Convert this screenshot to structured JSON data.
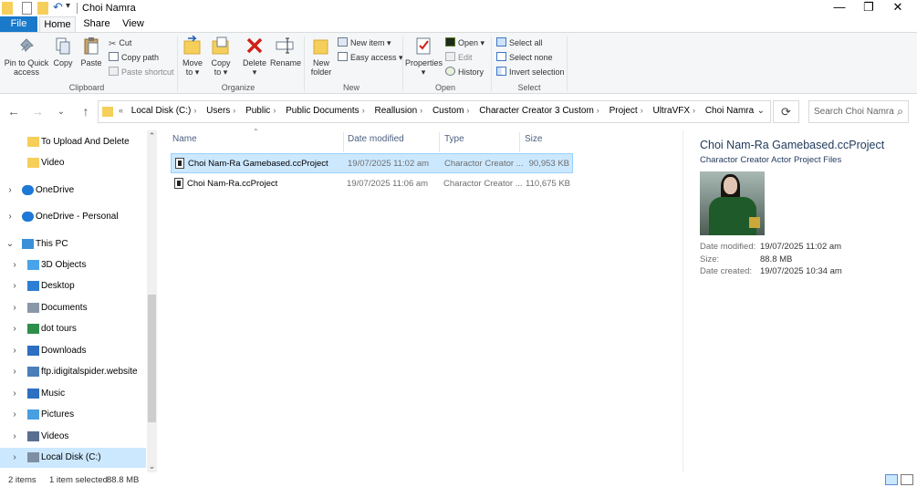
{
  "window": {
    "title": "Choi Namra",
    "minimize": "—",
    "maximize": "❐",
    "close": "✕"
  },
  "tabs": [
    "File",
    "Home",
    "Share",
    "View"
  ],
  "ribbon": {
    "clipboard": {
      "label": "Clipboard",
      "pin": [
        "Pin to Quick",
        "access"
      ],
      "copy": "Copy",
      "paste": "Paste",
      "cut": "Cut",
      "copy_path": "Copy path",
      "paste_shortcut": "Paste shortcut"
    },
    "organize": {
      "label": "Organize",
      "move_to": [
        "Move",
        "to ▾"
      ],
      "copy_to": [
        "Copy",
        "to ▾"
      ],
      "delete": [
        "Delete",
        "▾"
      ],
      "rename": "Rename"
    },
    "new": {
      "label": "New",
      "new_folder": [
        "New",
        "folder"
      ],
      "new_item": "New item ▾",
      "easy_access": "Easy access ▾"
    },
    "open": {
      "label": "Open",
      "properties": [
        "Properties",
        "▾"
      ],
      "open": "Open ▾",
      "edit": "Edit",
      "history": "History"
    },
    "select": {
      "label": "Select",
      "select_all": "Select all",
      "select_none": "Select none",
      "invert": "Invert selection"
    }
  },
  "address": {
    "prefix": "«",
    "crumbs": [
      "Local Disk (C:)",
      "Users",
      "Public",
      "Public Documents",
      "Reallusion",
      "Custom",
      "Character Creator 3 Custom",
      "Project",
      "UltraVFX",
      "Choi Namra"
    ],
    "search_placeholder": "Search Choi Namra"
  },
  "nav": [
    {
      "label": "To Upload And Delete",
      "icon": "folder-icon",
      "indent": 1,
      "expandable": false
    },
    {
      "label": "Video",
      "icon": "folder-icon",
      "indent": 1,
      "expandable": false
    },
    {
      "label": "OneDrive",
      "icon": "cloud-icon",
      "indent": 0,
      "expandable": true
    },
    {
      "label": "OneDrive - Personal",
      "icon": "cloud-icon",
      "indent": 0,
      "expandable": true
    },
    {
      "label": "This PC",
      "icon": "computer-icon",
      "indent": 0,
      "expandable": true,
      "expanded": true
    },
    {
      "label": "3D Objects",
      "icon": "cube-icon",
      "indent": 1,
      "expandable": true
    },
    {
      "label": "Desktop",
      "icon": "desktop-icon",
      "indent": 1,
      "expandable": true
    },
    {
      "label": "Documents",
      "icon": "documents-icon",
      "indent": 1,
      "expandable": true
    },
    {
      "label": "dot tours",
      "icon": "globe-icon",
      "indent": 1,
      "expandable": true
    },
    {
      "label": "Downloads",
      "icon": "download-icon",
      "indent": 1,
      "expandable": true
    },
    {
      "label": "ftp.idigitalspider.website",
      "icon": "network-icon",
      "indent": 1,
      "expandable": true
    },
    {
      "label": "Music",
      "icon": "music-icon",
      "indent": 1,
      "expandable": true
    },
    {
      "label": "Pictures",
      "icon": "pictures-icon",
      "indent": 1,
      "expandable": true
    },
    {
      "label": "Videos",
      "icon": "videos-icon",
      "indent": 1,
      "expandable": true
    },
    {
      "label": "Local Disk (C:)",
      "icon": "drive-icon",
      "indent": 1,
      "expandable": true,
      "selected": true
    }
  ],
  "columns": {
    "name": "Name",
    "date": "Date modified",
    "type": "Type",
    "size": "Size"
  },
  "files": [
    {
      "name": "Choi Nam-Ra Gamebased.ccProject",
      "date": "19/07/2025 11:02 am",
      "type": "Charactor Creator ...",
      "size": "90,953 KB",
      "selected": true
    },
    {
      "name": "Choi Nam-Ra.ccProject",
      "date": "19/07/2025 11:06 am",
      "type": "Charactor Creator ...",
      "size": "110,675 KB",
      "selected": false
    }
  ],
  "details": {
    "title": "Choi Nam-Ra Gamebased.ccProject",
    "subtitle": "Charactor Creator Actor Project Files",
    "props": [
      {
        "label": "Date modified:",
        "value": "19/07/2025 11:02 am"
      },
      {
        "label": "Size:",
        "value": "88.8 MB"
      },
      {
        "label": "Date created:",
        "value": "19/07/2025 10:34 am"
      }
    ]
  },
  "status": {
    "items": "2 items",
    "selected": "1 item selected",
    "size": "88.8 MB"
  },
  "colors": {
    "accent": "#1979ca",
    "selection": "#cce8ff",
    "folder": "#f6cf5a"
  }
}
